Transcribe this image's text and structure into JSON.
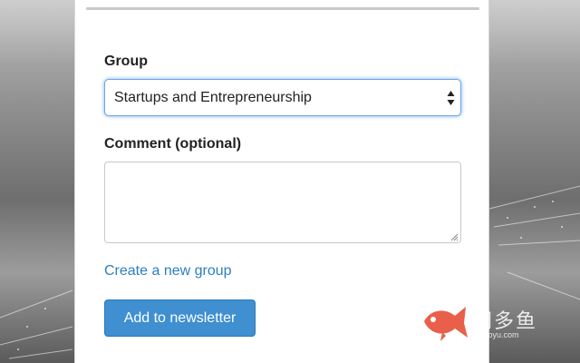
{
  "form": {
    "group_label": "Group",
    "group_selected": "Startups and Entrepreneurship",
    "comment_label": "Comment (optional)",
    "comment_value": "",
    "create_group_link": "Create a new group",
    "submit_label": "Add to newsletter"
  },
  "watermark": {
    "logo_text": "网多鱼",
    "url_text": "wduoyu.com"
  },
  "colors": {
    "link": "#2b7fc2",
    "button": "#3f8fd1",
    "focus_ring": "#6aa6e8",
    "watermark_fish": "#e8604a"
  },
  "icons": {
    "select": "up-down-arrows-icon",
    "textarea_resize": "resize-grip-icon",
    "watermark": "fish-logo-icon"
  }
}
